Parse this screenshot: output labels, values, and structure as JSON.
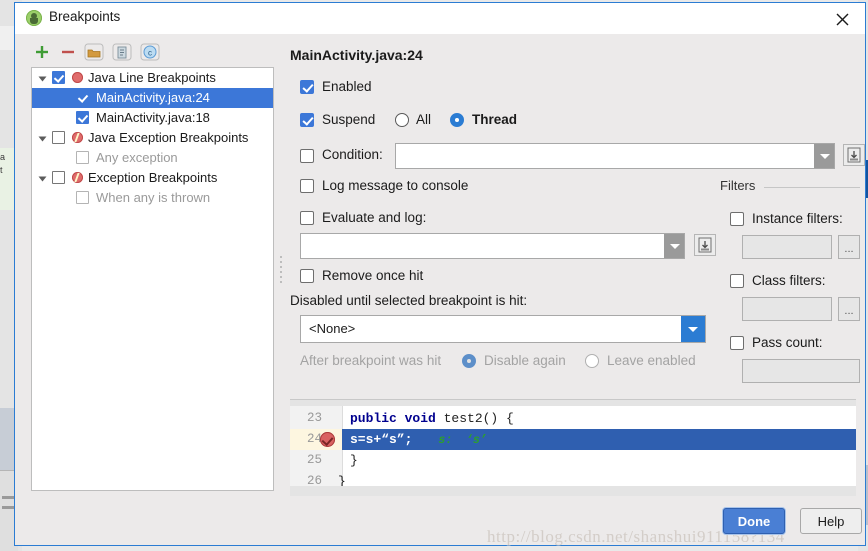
{
  "window": {
    "title": "Breakpoints",
    "app_icon": "android-studio-icon",
    "close_label": "✕"
  },
  "toolbar": {
    "add_label": "+",
    "remove_label": "−",
    "group_label": "folder-icon",
    "document_label": "document-icon",
    "class_label": "c"
  },
  "tree": {
    "items": [
      {
        "label": "Java Line Breakpoints",
        "indent": 40,
        "checked": true,
        "icon": "red-dot",
        "selected": false,
        "dim": false,
        "arrow": true
      },
      {
        "label": "MainActivity.java:24",
        "indent": 62,
        "checked": true,
        "icon": "none",
        "selected": true,
        "dim": false,
        "arrow": false
      },
      {
        "label": "MainActivity.java:18",
        "indent": 62,
        "checked": true,
        "icon": "none",
        "selected": false,
        "dim": false,
        "arrow": false
      },
      {
        "label": "Java Exception Breakpoints",
        "indent": 40,
        "checked": false,
        "icon": "bolt",
        "selected": false,
        "dim": false,
        "arrow": true
      },
      {
        "label": "Any exception",
        "indent": 42,
        "checked": false,
        "icon": "none",
        "selected": false,
        "dim": true,
        "arrow": false
      },
      {
        "label": "Exception Breakpoints",
        "indent": 40,
        "checked": false,
        "icon": "bolt",
        "selected": false,
        "dim": false,
        "arrow": true
      },
      {
        "label": "When any is thrown",
        "indent": 42,
        "checked": false,
        "icon": "none",
        "selected": false,
        "dim": true,
        "arrow": false
      }
    ]
  },
  "detail": {
    "title": "MainActivity.java:24",
    "enabled": {
      "label": "Enabled",
      "checked": true
    },
    "suspend": {
      "label": "Suspend",
      "checked": true
    },
    "suspend_all": {
      "label": "All",
      "selected": false
    },
    "suspend_thread": {
      "label": "Thread",
      "selected": true
    },
    "condition": {
      "label": "Condition:",
      "checked": false,
      "value": ""
    },
    "log_message": {
      "label": "Log message to console",
      "checked": false
    },
    "evaluate_and_log": {
      "label": "Evaluate and log:",
      "checked": false,
      "value": ""
    },
    "remove_once_hit": {
      "label": "Remove once hit",
      "checked": false
    },
    "disabled_until": {
      "label": "Disabled until selected breakpoint is hit:",
      "value": "<None>"
    },
    "after_hit": {
      "label": "After breakpoint was hit",
      "disable_again": {
        "label": "Disable again",
        "selected": true
      },
      "leave_enabled": {
        "label": "Leave enabled",
        "selected": false
      }
    }
  },
  "filters": {
    "legend": "Filters",
    "instance": {
      "label": "Instance filters:",
      "checked": false,
      "value": "",
      "browse_label": "..."
    },
    "class": {
      "label": "Class filters:",
      "checked": false,
      "value": "",
      "browse_label": "..."
    },
    "pass_count": {
      "label": "Pass count:",
      "checked": false,
      "value": ""
    }
  },
  "code_preview": {
    "lines": [
      {
        "number": "23",
        "keyword": "public void ",
        "rest": "test2() {",
        "highlighted": false,
        "breakpoint": false,
        "hint": ""
      },
      {
        "number": "24",
        "keyword": "",
        "rest": "s=s+“s”;",
        "highlighted": true,
        "breakpoint": true,
        "hint": "s:  ‘s’"
      },
      {
        "number": "25",
        "keyword": "",
        "rest": "}",
        "highlighted": false,
        "breakpoint": false,
        "hint": ""
      },
      {
        "number": "26",
        "keyword": "",
        "rest": "}",
        "highlighted": false,
        "breakpoint": false,
        "hint": ""
      }
    ]
  },
  "buttons": {
    "done": "Done",
    "help": "Help"
  },
  "watermark": "http://blog.csdn.net/shanshui911158?134",
  "colors": {
    "accent": "#3c77d8",
    "selection": "#2f5fb0",
    "dialog_border": "#2b7cd3",
    "breakpoint_red": "#e06c6c",
    "keyword_blue": "#00008f",
    "hint_green": "#2ca02c"
  }
}
